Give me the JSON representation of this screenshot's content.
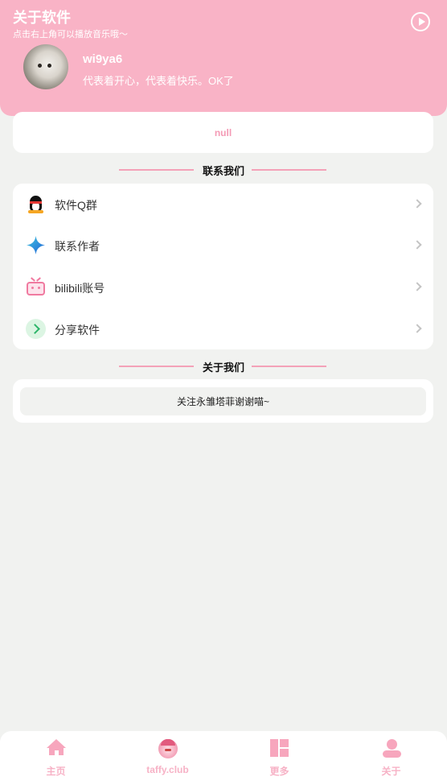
{
  "header": {
    "title": "关于软件",
    "subtitle": "点击右上角可以播放音乐哦～",
    "play_icon": "play-circle-icon",
    "username": "wi9ya6",
    "bio": "代表着开心，代表着快乐。OK了",
    "background_color": "#f9b3c6"
  },
  "status_card": {
    "text": "null"
  },
  "contact_section": {
    "title": "联系我们",
    "items": [
      {
        "label": "软件Q群",
        "icon": "qq-penguin-icon"
      },
      {
        "label": "联系作者",
        "icon": "star-sparkle-icon"
      },
      {
        "label": "bilibili账号",
        "icon": "bilibili-tv-icon"
      },
      {
        "label": "分享软件",
        "icon": "share-arrow-icon"
      }
    ]
  },
  "about_section": {
    "title": "关于我们",
    "button_label": "关注永雏塔菲谢谢喵~"
  },
  "bottom_nav": {
    "items": [
      {
        "label": "主页",
        "icon": "home-icon"
      },
      {
        "label": "taffy.club",
        "icon": "taffy-avatar-icon"
      },
      {
        "label": "更多",
        "icon": "grid-blocks-icon"
      },
      {
        "label": "关于",
        "icon": "person-icon"
      }
    ],
    "active_color": "#f7b2c6"
  }
}
